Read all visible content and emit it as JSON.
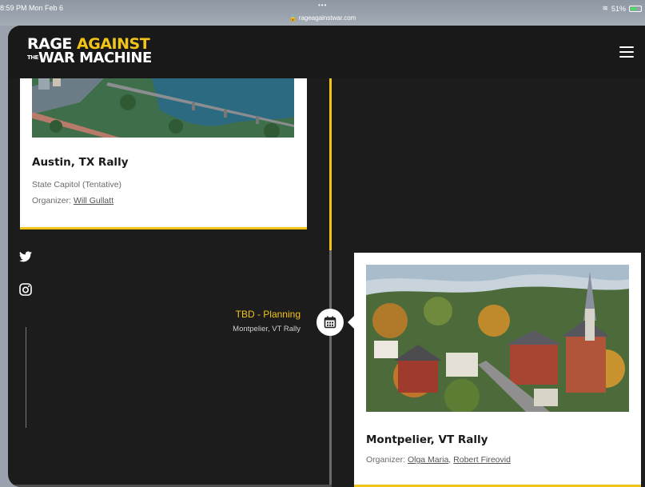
{
  "status_bar": {
    "time": "8:59 PM  Mon Feb 6",
    "dots": "•••",
    "url": "rageagainstwar.com",
    "right": "51%"
  },
  "header": {
    "logo_line1_a": "RAGE ",
    "logo_line1_b": "AGAINST",
    "logo_the": "THE",
    "logo_line2": "WAR MACHINE",
    "menu_icon": "hamburger-icon"
  },
  "events": [
    {
      "title": "Austin, TX Rally",
      "location": "State Capitol (Tentative)",
      "organizer_label": "Organizer: ",
      "organizers": [
        "Will Gullatt"
      ]
    },
    {
      "date": "TBD - Planning",
      "subtitle": "Montpelier, VT Rally",
      "title": "Montpelier, VT Rally",
      "organizer_label": "Organizer: ",
      "organizers": [
        "Olga Maria",
        "Robert Fireovid"
      ],
      "separator": ", "
    }
  ],
  "social": [
    "twitter-icon",
    "instagram-icon"
  ],
  "colors": {
    "accent": "#f2c417",
    "background": "#1c1c1c",
    "card": "#ffffff"
  }
}
